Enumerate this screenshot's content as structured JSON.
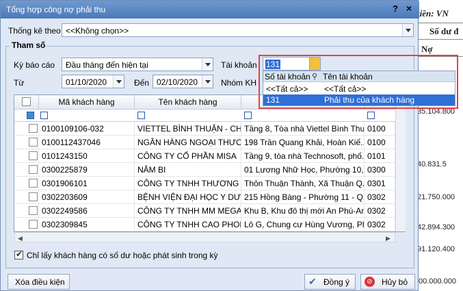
{
  "window": {
    "title": "Tổng hợp công nợ phải thu",
    "help": "?",
    "close": "×"
  },
  "background_doc": {
    "title": "tiền: VN",
    "header1": "Số dư đ",
    "header2": "Nợ",
    "numbers": [
      "35.104.800",
      "40.831.5",
      "21.750.000",
      "42.894.300",
      "91.120.400",
      "00.000.000"
    ]
  },
  "thong_ke": {
    "label": "Thống kê theo",
    "value": "<<Không chọn>>"
  },
  "params": {
    "group_label": "Tham số",
    "ky_bao_cao_label": "Kỳ báo cáo",
    "ky_bao_cao_value": "Đầu tháng đến hiện tại",
    "tu_label": "Từ",
    "tu_value": "01/10/2020",
    "den_label": "Đến",
    "den_value": "02/10/2020",
    "tai_khoan_label": "Tài khoản",
    "tai_khoan_value": "131",
    "nhom_kh_label": "Nhóm KH"
  },
  "account_dropdown": {
    "col1": "Số tài khoản",
    "col2": "Tên tài khoản",
    "rows": [
      {
        "so": "<<Tất cả>>",
        "ten": "<<Tất cả>>"
      },
      {
        "so": "131",
        "ten": "Phải thu của khách hàng"
      }
    ]
  },
  "grid": {
    "columns": [
      "Mã khách hàng",
      "Tên khách hàng",
      "",
      ""
    ],
    "rows": [
      {
        "ma": "0100109106-032",
        "ten": "VIETTEL BÌNH THUẬN - CHI...",
        "dc": "Tầng 8, Tòa nhà Viettel Bình Thu...",
        "x": "0100"
      },
      {
        "ma": "0100112437046",
        "ten": "NGÂN HÀNG NGOẠI THƯƠN...",
        "dc": "198 Trần Quang Khải, Hoàn Kiế...",
        "x": "0100"
      },
      {
        "ma": "0101243150",
        "ten": "CÔNG TY CỔ PHẦN MISA",
        "dc": "Tầng 9, tòa nhà Technosoft, phố...",
        "x": "0101"
      },
      {
        "ma": "0300225879",
        "ten": "NĂM BI",
        "dc": "01 Lương Nhữ Học, Phường 10, ...",
        "x": "0300"
      },
      {
        "ma": "0301906101",
        "ten": "CÔNG TY TNHH THƯƠNG M...",
        "dc": "Thôn Thuận Thành, Xã Thuận Q...",
        "x": "0301"
      },
      {
        "ma": "0302203609",
        "ten": "BỆNH VIỆN ĐẠI HỌC Y DƯỢ...",
        "dc": "215 Hồng Bàng - Phường 11 - Q...",
        "x": "0302"
      },
      {
        "ma": "0302249586",
        "ten": "CÔNG TY TNHH MM MEGA M...",
        "dc": "Khu B, Khu đô thị mới An Phú-An...",
        "x": "0302"
      },
      {
        "ma": "0302309845",
        "ten": "CÔNG TY TNHH CAO PHONG",
        "dc": "Lô G, Chung cư Hùng Vương, Ph...",
        "x": "0302"
      }
    ]
  },
  "only_customers_label": "Chỉ lấy khách hàng có số dư hoặc phát sinh trong kỳ",
  "buttons": {
    "clear": "Xóa điều kiện",
    "ok": "Đồng ý",
    "cancel": "Hủy bỏ"
  }
}
